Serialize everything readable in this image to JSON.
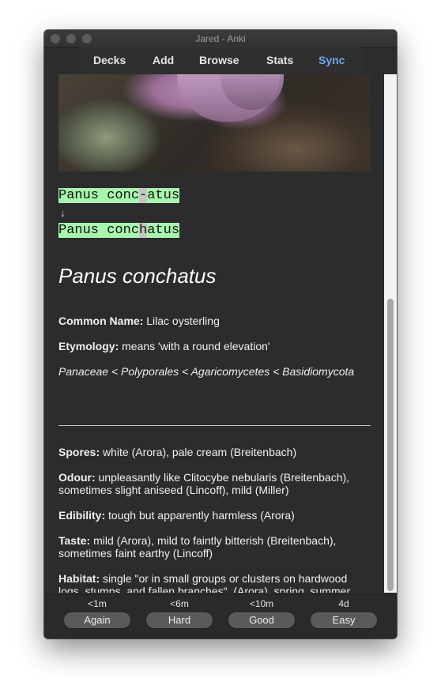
{
  "window": {
    "title": "Jared - Anki"
  },
  "toolbar": {
    "decks": "Decks",
    "add": "Add",
    "browse": "Browse",
    "stats": "Stats",
    "sync": "Sync"
  },
  "card": {
    "typed_before": "Panus conc",
    "typed_gap": "-",
    "typed_after": "atus",
    "arrow": "↓",
    "correct_before": "Panus conc",
    "correct_diff": "h",
    "correct_after": "atus",
    "species": "Panus conchatus",
    "common_name_label": "Common Name:",
    "common_name": " Lilac oysterling",
    "etymology_label": "Etymology:",
    "etymology": " means 'with a round elevation'",
    "taxonomy": "Panaceae < Polyporales < Agaricomycetes < Basidiomycota",
    "spores_label": "Spores:",
    "spores": " white (Arora), pale cream (Breitenbach)",
    "odour_label": "Odour:",
    "odour": " unpleasantly like Clitocybe nebularis (Breitenbach), sometimes slight aniseed (Lincoff), mild (Miller)",
    "edibility_label": "Edibility:",
    "edibility": " tough but apparently harmless (Arora)",
    "taste_label": "Taste:",
    "taste": " mild (Arora), mild to faintly bitterish (Breitenbach), sometimes faint earthy (Lincoff)",
    "habitat_label": "Habitat:",
    "habitat": " single \"or in small groups or clusters on hardwood logs, stumps, and fallen branches\", (Arora), spring, summer, fall, and on the west coast in winter, (Miller)"
  },
  "answers": [
    {
      "interval": "<1m",
      "label": "Again"
    },
    {
      "interval": "<6m",
      "label": "Hard"
    },
    {
      "interval": "<10m",
      "label": "Good"
    },
    {
      "interval": "4d",
      "label": "Easy"
    }
  ]
}
